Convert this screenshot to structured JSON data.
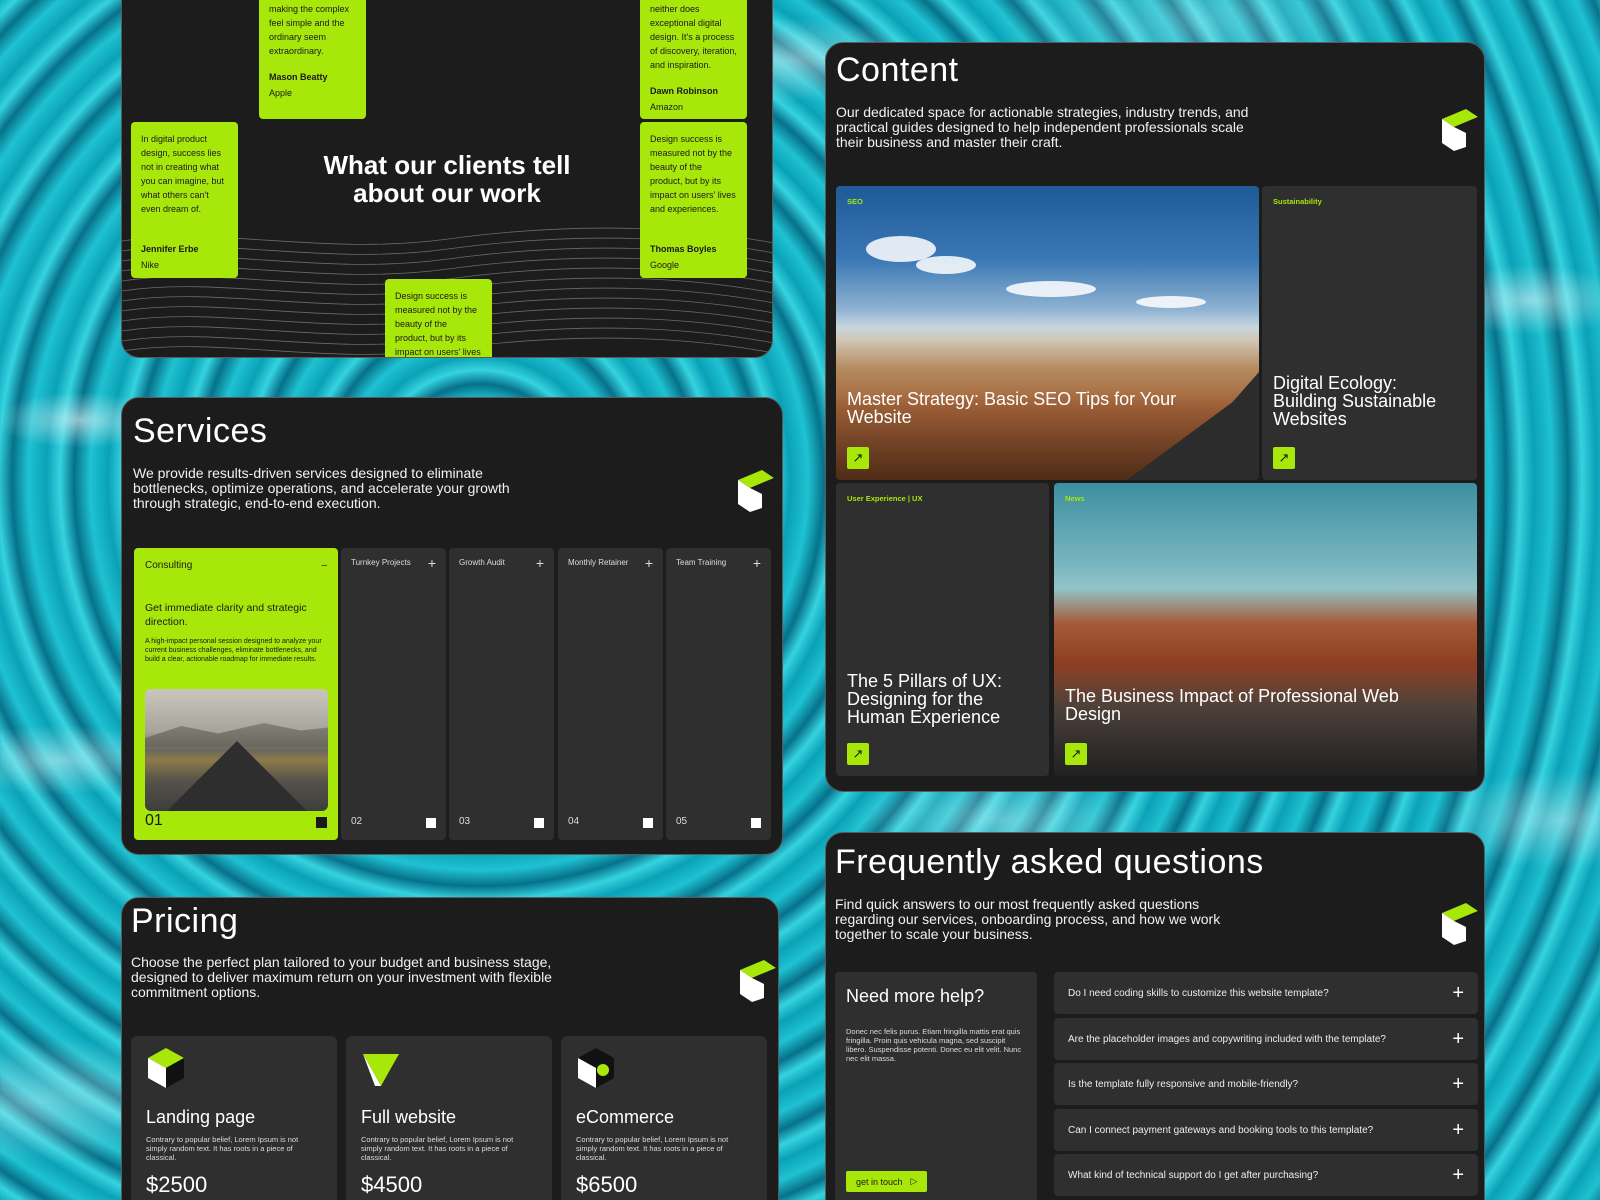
{
  "testimonials": {
    "heading": "What our clients  tell about our work",
    "cards": [
      {
        "quote": "making the complex feel simple and the ordinary seem extraordinary.",
        "name": "Mason Beatty",
        "company": "Apple"
      },
      {
        "quote": "neither does exceptional digital design. It's a process of discovery, iteration, and inspiration.",
        "name": "Dawn Robinson",
        "company": "Amazon"
      },
      {
        "quote": "In digital product design, success lies not in creating what you can imagine, but what others can't even dream of.",
        "name": "Jennifer Erbe",
        "company": "Nike"
      },
      {
        "quote": "Design success is measured not by the beauty of the product, but by its impact on users' lives and experiences.",
        "name": "Thomas Boyles",
        "company": "Google"
      },
      {
        "quote": "Design success is measured not by the beauty of the product, but by its impact on users' lives and",
        "name": "",
        "company": ""
      }
    ]
  },
  "services": {
    "title": "Services",
    "description": "We provide results-driven services designed to eliminate bottlenecks, optimize operations, and accelerate your growth through strategic, end-to-end execution.",
    "active": {
      "label": "Consulting",
      "toggle": "–",
      "lead": "Get immediate clarity and strategic direction.",
      "detail": "A high-impact personal session designed to analyze your current business challenges, eliminate bottlenecks, and build a clear, actionable roadmap for immediate results.",
      "number": "01"
    },
    "items": [
      {
        "label": "Turnkey Projects",
        "number": "02"
      },
      {
        "label": "Growth Audit",
        "number": "03"
      },
      {
        "label": "Monthly Retainer",
        "number": "04"
      },
      {
        "label": "Team Training",
        "number": "05"
      }
    ],
    "plus": "+"
  },
  "pricing": {
    "title": "Pricing",
    "description": "Choose the perfect plan tailored to your budget and business stage, designed to deliver maximum return on your investment with flexible commitment options.",
    "plans": [
      {
        "name": "Landing page",
        "desc": "Contrary to popular belief, Lorem Ipsum is not simply random text. It has roots in a piece of classical.",
        "price": "$2500"
      },
      {
        "name": "Full website",
        "desc": "Contrary to popular belief, Lorem Ipsum is not simply random text. It has roots in a piece of classical.",
        "price": "$4500"
      },
      {
        "name": "eCommerce",
        "desc": "Contrary to popular belief, Lorem Ipsum is not simply random text. It has roots in a piece of classical.",
        "price": "$6500"
      }
    ]
  },
  "content": {
    "title": "Content",
    "description": "Our dedicated space for actionable strategies, industry trends, and practical guides designed to help independent professionals scale their business and master their craft.",
    "arrow": "↗",
    "articles": [
      {
        "tag": "SEO",
        "title": "Master Strategy: Basic SEO Tips for Your Website"
      },
      {
        "tag": "Sustainability",
        "title": "Digital Ecology: Building Sustainable Websites"
      },
      {
        "tag": "User Experience | UX",
        "title": "The 5 Pillars of UX: Designing for the Human Experience"
      },
      {
        "tag": "News",
        "title": "The Business Impact of Professional Web Design"
      }
    ]
  },
  "faq": {
    "title": "Frequently asked questions",
    "description": "Find quick answers to our most frequently asked questions regarding our services, onboarding process, and how we work together to scale your business.",
    "help": {
      "title": "Need more help?",
      "text": "Donec nec felis purus. Etiam fringilla mattis erat quis fringilla. Proin quis vehicula magna, sed suscipit libero. Suspendisse potenti. Donec eu elit velit. Nunc nec elit massa.",
      "button": "get in touch",
      "button_icon": "▷"
    },
    "plus": "+",
    "questions": [
      "Do I need coding skills to customize this website template?",
      "Are the placeholder images and copywriting included with the template?",
      "Is the template fully responsive and mobile-friendly?",
      "Can I connect payment gateways and booking tools to this template?",
      "What kind of technical support do I get after purchasing?"
    ]
  },
  "colors": {
    "accent": "#a8e70a",
    "panel": "#1c1c1c",
    "card": "#2f2f2f"
  },
  "icons": [
    "brand-logo-icon",
    "plus-icon",
    "minus-icon",
    "arrow-up-right-icon",
    "play-arrow-icon",
    "cube-icon"
  ]
}
